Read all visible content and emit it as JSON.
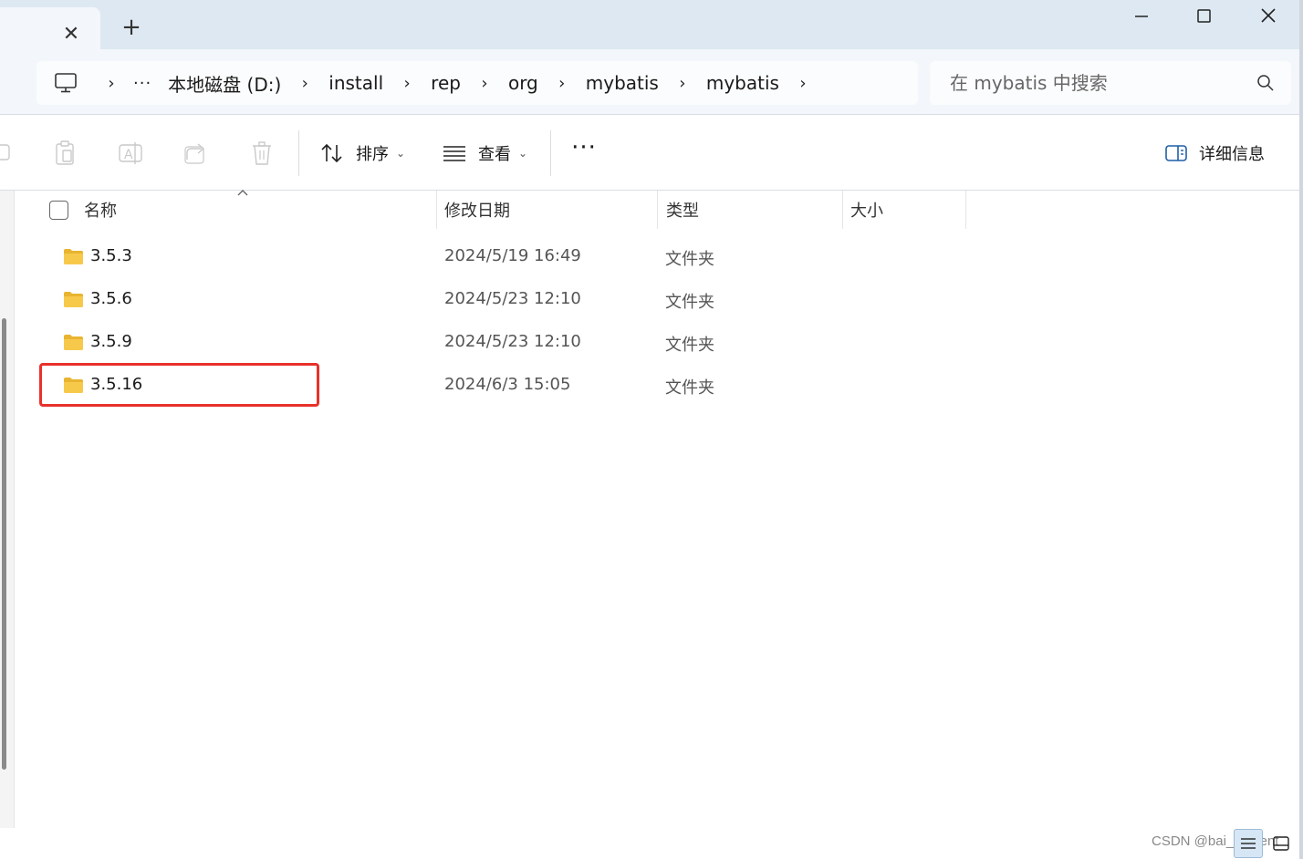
{
  "window": {
    "tab_close_glyph": "✕",
    "new_tab_glyph": "+"
  },
  "address": {
    "more_glyph": "···",
    "crumbs": [
      "本地磁盘 (D:)",
      "install",
      "rep",
      "org",
      "mybatis",
      "mybatis"
    ],
    "separator": "›"
  },
  "search": {
    "placeholder": "在 mybatis 中搜索"
  },
  "toolbar": {
    "sort_label": "排序",
    "view_label": "查看",
    "more_glyph": "···",
    "details_label": "详细信息",
    "dropdown_glyph": "⌄"
  },
  "columns": {
    "name": "名称",
    "modified": "修改日期",
    "type": "类型",
    "size": "大小"
  },
  "files": [
    {
      "name": "3.5.3",
      "modified": "2024/5/19 16:49",
      "type": "文件夹",
      "size": ""
    },
    {
      "name": "3.5.6",
      "modified": "2024/5/23 12:10",
      "type": "文件夹",
      "size": ""
    },
    {
      "name": "3.5.9",
      "modified": "2024/5/23 12:10",
      "type": "文件夹",
      "size": ""
    },
    {
      "name": "3.5.16",
      "modified": "2024/6/3 15:05",
      "type": "文件夹",
      "size": ""
    }
  ],
  "highlighted_file": "3.5.16",
  "watermark": "CSDN @bai_student",
  "colors": {
    "highlight_border": "#e8312a",
    "folder_yellow": "#f7c94b",
    "title_bar_bg": "#dde8f2"
  }
}
